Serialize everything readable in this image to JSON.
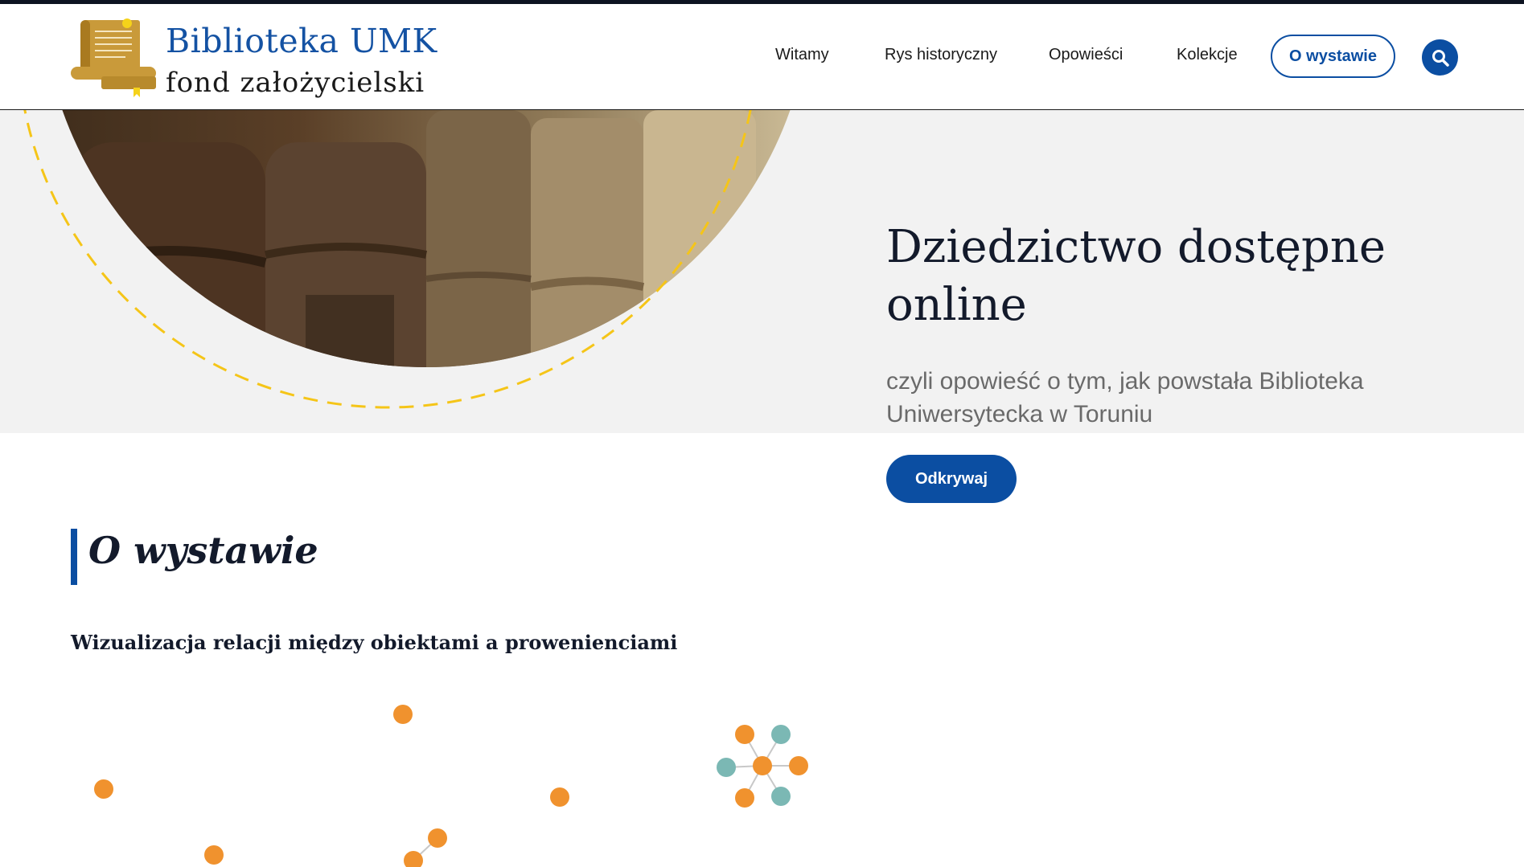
{
  "header": {
    "logo_title": "Biblioteka UMK",
    "logo_subtitle": "fond założycielski",
    "nav": [
      "Witamy",
      "Rys historyczny",
      "Opowieści",
      "Kolekcje"
    ],
    "nav_active": "O wystawie",
    "search_icon": "search-icon"
  },
  "hero": {
    "title": "Dziedzictwo dostępne online",
    "subtitle": "czyli opowieść o tym, jak powstała Biblioteka Uniwersytecka w Toruniu",
    "cta": "Odkrywaj"
  },
  "section": {
    "title": "O wystawie",
    "subtitle": "Wizualizacja relacji między obiektami a prowenienciami"
  },
  "colors": {
    "accent": "#0b4ea2",
    "node_orange": "#f0922e",
    "node_teal": "#7bb8b4",
    "dashed_ring": "#f5c518",
    "dark_text": "#131a2b"
  }
}
